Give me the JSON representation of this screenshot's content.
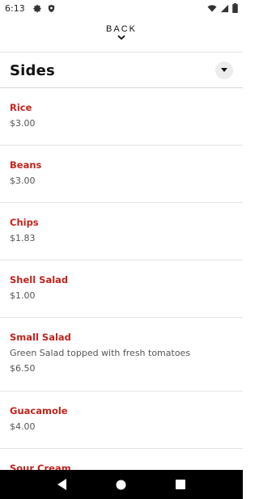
{
  "status_bar": {
    "time": "6:13",
    "left_icons": [
      "gear-icon",
      "shield-icon"
    ],
    "right_icons": [
      "wifi-icon",
      "signal-icon",
      "battery-icon"
    ]
  },
  "header": {
    "back_label": "BACK"
  },
  "category": {
    "title": "Sides"
  },
  "items": [
    {
      "name": "Rice",
      "description": "",
      "price": "$3.00"
    },
    {
      "name": "Beans",
      "description": "",
      "price": "$3.00"
    },
    {
      "name": "Chips",
      "description": "",
      "price": "$1.83"
    },
    {
      "name": "Shell Salad",
      "description": "",
      "price": "$1.00"
    },
    {
      "name": "Small Salad",
      "description": "Green Salad topped with fresh tomatoes",
      "price": "$6.50"
    },
    {
      "name": "Guacamole",
      "description": "",
      "price": "$4.00"
    },
    {
      "name": "Sour Cream",
      "description": "",
      "price": ""
    }
  ],
  "nav_bar": {
    "buttons": [
      "back-triangle-icon",
      "home-circle-icon",
      "recents-square-icon"
    ]
  }
}
